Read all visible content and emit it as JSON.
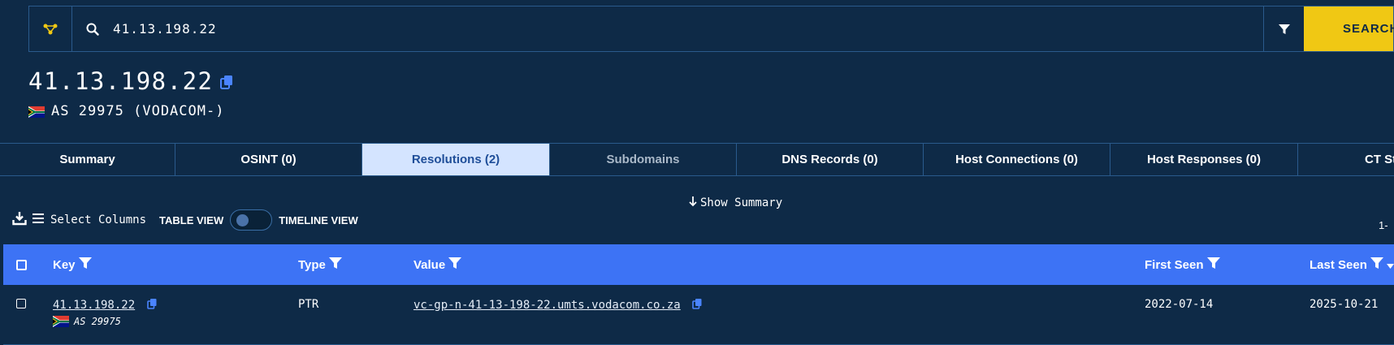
{
  "search": {
    "value": "41.13.198.22",
    "button_label": "SEARCH"
  },
  "header": {
    "ip": "41.13.198.22",
    "asn_label": "AS 29975 (VODACOM-)"
  },
  "tabs": [
    {
      "label": "Summary",
      "state": "normal"
    },
    {
      "label": "OSINT (0)",
      "state": "normal"
    },
    {
      "label": "Resolutions (2)",
      "state": "active"
    },
    {
      "label": "Subdomains",
      "state": "disabled"
    },
    {
      "label": "DNS Records (0)",
      "state": "normal"
    },
    {
      "label": "Host Connections (0)",
      "state": "normal"
    },
    {
      "label": "Host Responses (0)",
      "state": "normal"
    },
    {
      "label": "CT St",
      "state": "normal"
    }
  ],
  "toolbar": {
    "show_summary": "Show Summary",
    "select_columns": "Select Columns",
    "table_view": "TABLE VIEW",
    "timeline_view": "TIMELINE VIEW",
    "pager": "1-"
  },
  "table": {
    "headers": {
      "key": "Key",
      "type": "Type",
      "value": "Value",
      "first_seen": "First Seen",
      "last_seen": "Last Seen"
    },
    "rows": [
      {
        "key": "41.13.198.22",
        "key_asn": "AS 29975",
        "type": "PTR",
        "value": "vc-gp-n-41-13-198-22.umts.vodacom.co.za",
        "first_seen": "2022-07-14",
        "last_seen": "2025-10-21"
      }
    ]
  },
  "colors": {
    "background": "#0e2a47",
    "accent_blue": "#3d73f5",
    "search_button": "#f0c814",
    "active_tab_bg": "#d4e4ff",
    "copy_icon": "#4a84ff"
  }
}
